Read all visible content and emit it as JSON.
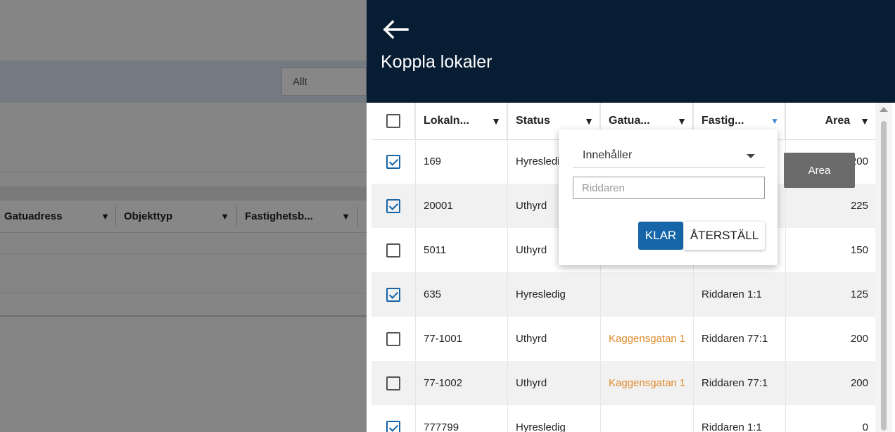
{
  "background": {
    "select_value": "Allt",
    "columns": [
      "Gatuadress",
      "Objekttyp",
      "Fastighetsb..."
    ]
  },
  "panel": {
    "title": "Koppla lokaler",
    "columns": [
      {
        "label": "Lokaln...",
        "filter": "funnel-icon"
      },
      {
        "label": "Status",
        "filter": "funnel-icon"
      },
      {
        "label": "Gatua...",
        "filter": "funnel-icon"
      },
      {
        "label": "Fastig...",
        "filter": "funnel-active-icon"
      },
      {
        "label": "Area",
        "filter": "funnel-icon"
      }
    ],
    "rows": [
      {
        "checked": true,
        "lokal": "169",
        "status": "Hyresledig",
        "gatuadress": "",
        "fastighet": "",
        "area": "200"
      },
      {
        "checked": true,
        "lokal": "20001",
        "status": "Uthyrd",
        "gatuadress": "",
        "fastighet": "",
        "area": "225"
      },
      {
        "checked": false,
        "lokal": "5011",
        "status": "Uthyrd",
        "gatuadress": "",
        "fastighet": "",
        "area": "150"
      },
      {
        "checked": true,
        "lokal": "635",
        "status": "Hyresledig",
        "gatuadress": "",
        "fastighet": "Riddaren 1:1",
        "area": "125"
      },
      {
        "checked": false,
        "lokal": "77-1001",
        "status": "Uthyrd",
        "gatuadress": "Kaggensgatan 1",
        "fastighet": "Riddaren 77:1",
        "area": "200"
      },
      {
        "checked": false,
        "lokal": "77-1002",
        "status": "Uthyrd",
        "gatuadress": "Kaggensgatan 1",
        "fastighet": "Riddaren 77:1",
        "area": "200"
      },
      {
        "checked": true,
        "lokal": "777799",
        "status": "Hyresledig",
        "gatuadress": "",
        "fastighet": "Riddaren 1:1",
        "area": "0"
      }
    ]
  },
  "filter_popup": {
    "operator": "Innehåller",
    "value": "Riddaren",
    "apply_label": "KLAR",
    "reset_label": "ÅTERSTÄLL"
  },
  "tooltip": {
    "text": "Area"
  },
  "colors": {
    "header_bg": "#071d33",
    "primary": "#1565a8",
    "link_orange": "#e08a2a"
  }
}
